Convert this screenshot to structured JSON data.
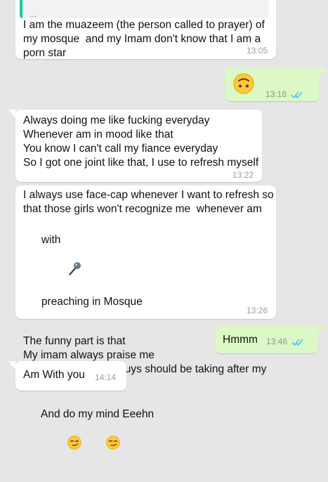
{
  "chat": {
    "messages": [
      {
        "id": "m1",
        "direction": "incoming",
        "quote_text": "...",
        "lines": [
          "I am the muazeem (the person called to prayer) of",
          "my mosque  and my Imam don't know that I am a",
          "porn star"
        ],
        "time": "13:05"
      },
      {
        "id": "m2",
        "direction": "outgoing",
        "emoji": "upside-down-face",
        "time": "13:18",
        "status": "read"
      },
      {
        "id": "m3",
        "direction": "incoming",
        "lines": [
          "Always doing me like fucking everyday",
          "Whenever am in mood like that",
          "You know I can't call my fiance everyday",
          "So I got one joint like that, I use to refresh myself"
        ],
        "time": "13:22"
      },
      {
        "id": "m4",
        "direction": "incoming",
        "lines": [
          "I always use face-cap whenever I want to refresh so",
          "that those girls won't recognize me  whenever am",
          "with",
          "preaching in Mosque",
          "",
          "The funny part is that",
          "My imam always praise me",
          "Even he said some guys should be taking after my",
          "steps",
          "And do my mind Eeehn"
        ],
        "inline_icon": "microphone-icon",
        "trailing_emojis": [
          "smirking-face",
          "smirking-face"
        ],
        "time": "13:26"
      },
      {
        "id": "m5",
        "direction": "outgoing",
        "text": "Hmmm",
        "time": "13:46",
        "status": "read"
      },
      {
        "id": "m6",
        "direction": "incoming",
        "text": "Am With you",
        "time": "14:14"
      }
    ]
  },
  "colors": {
    "background": "#e6e6e6",
    "incoming_bubble": "#ffffff",
    "outgoing_bubble": "#dcf8c6",
    "read_ticks": "#4fc3f7",
    "quote_bar": "#06cf9c"
  }
}
